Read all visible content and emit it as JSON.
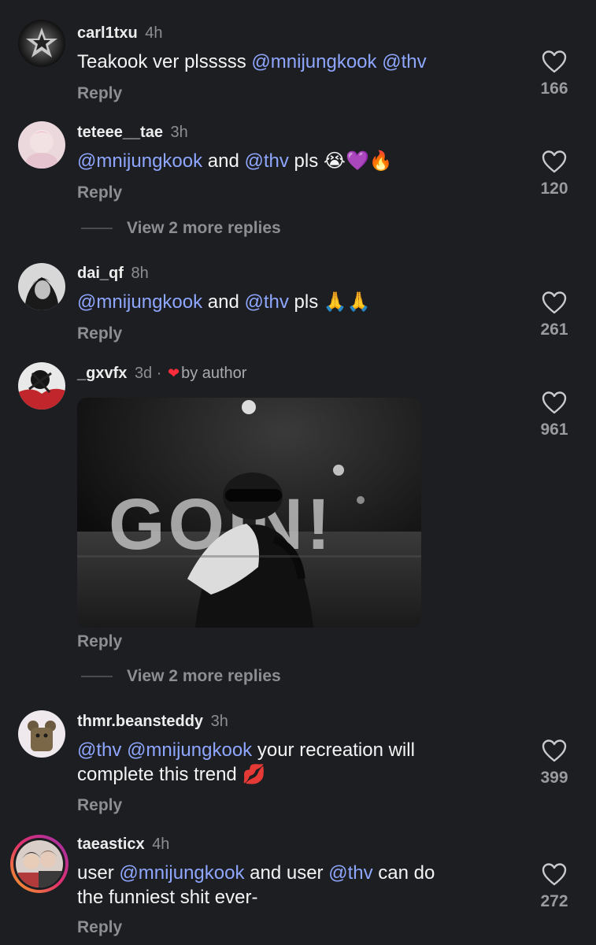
{
  "comments": [
    {
      "username": "carl1txu",
      "time": "4h",
      "parts": [
        "Teakook ver plsssss ",
        "@mnijungkook",
        " ",
        "@thv"
      ],
      "reply": "Reply",
      "likes": "166"
    },
    {
      "username": "teteee__tae",
      "time": "3h",
      "parts": [
        "@mnijungkook",
        " and ",
        "@thv",
        " pls "
      ],
      "emojis": "😭💜🔥",
      "reply": "Reply",
      "likes": "120",
      "more_replies": "View 2 more replies"
    },
    {
      "username": "dai_qf",
      "time": "8h",
      "parts": [
        "@mnijungkook",
        " and ",
        "@thv",
        " pls "
      ],
      "emojis": "🙏🙏",
      "reply": "Reply",
      "likes": "261"
    },
    {
      "username": "_gxvfx",
      "time": "3d",
      "separator": "·",
      "badge": "by author",
      "gif_text": "GOIN!",
      "reply": "Reply",
      "likes": "961",
      "more_replies": "View 2 more replies"
    },
    {
      "username": "thmr.beansteddy",
      "time": "3h",
      "line1": [
        "@thv",
        " ",
        "@mnijungkook",
        " your recreation will"
      ],
      "line2": "complete this trend ",
      "emojis": "💋",
      "reply": "Reply",
      "likes": "399"
    },
    {
      "username": "taeasticx",
      "time": "4h",
      "line1": [
        "user ",
        "@mnijungkook",
        " and user ",
        "@thv",
        " can do"
      ],
      "line2": "the funniest shit ever-",
      "reply": "Reply",
      "likes": "272"
    }
  ],
  "icons": {
    "like": "heart-outline-icon",
    "author_like": "heart-filled-icon"
  },
  "colors": {
    "background": "#1c1e21",
    "mention": "#8fa6ff",
    "muted": "#8d8e92",
    "author_heart": "#ff2d3b"
  }
}
